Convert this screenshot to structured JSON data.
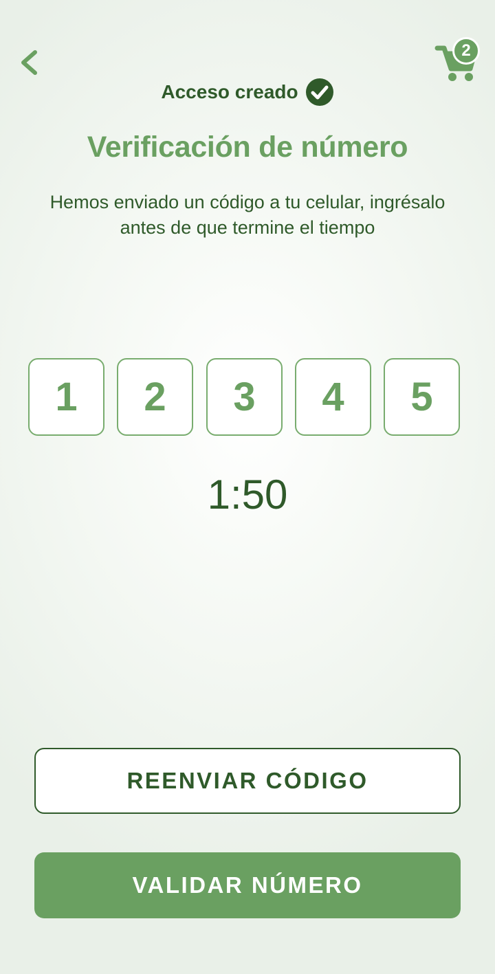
{
  "header": {
    "back_icon": "chevron-left-icon",
    "cart_icon": "cart-icon",
    "cart_count": "2"
  },
  "status": {
    "text": "Acceso creado",
    "icon": "check-circle-icon"
  },
  "title": "Verificación de número",
  "subtitle_lines": [
    "Hemos enviado un código a tu celular, ingrésalo",
    "antes de que termine el tiempo"
  ],
  "code_digits": [
    "1",
    "2",
    "3",
    "4",
    "5"
  ],
  "timer": "1:50",
  "buttons": {
    "resend": "REENVIAR CÓDIGO",
    "validate": "VALIDAR NÚMERO"
  },
  "colors": {
    "primary_green": "#6aa061",
    "dark_green": "#2f5a2a",
    "background": "#eef3ed"
  }
}
